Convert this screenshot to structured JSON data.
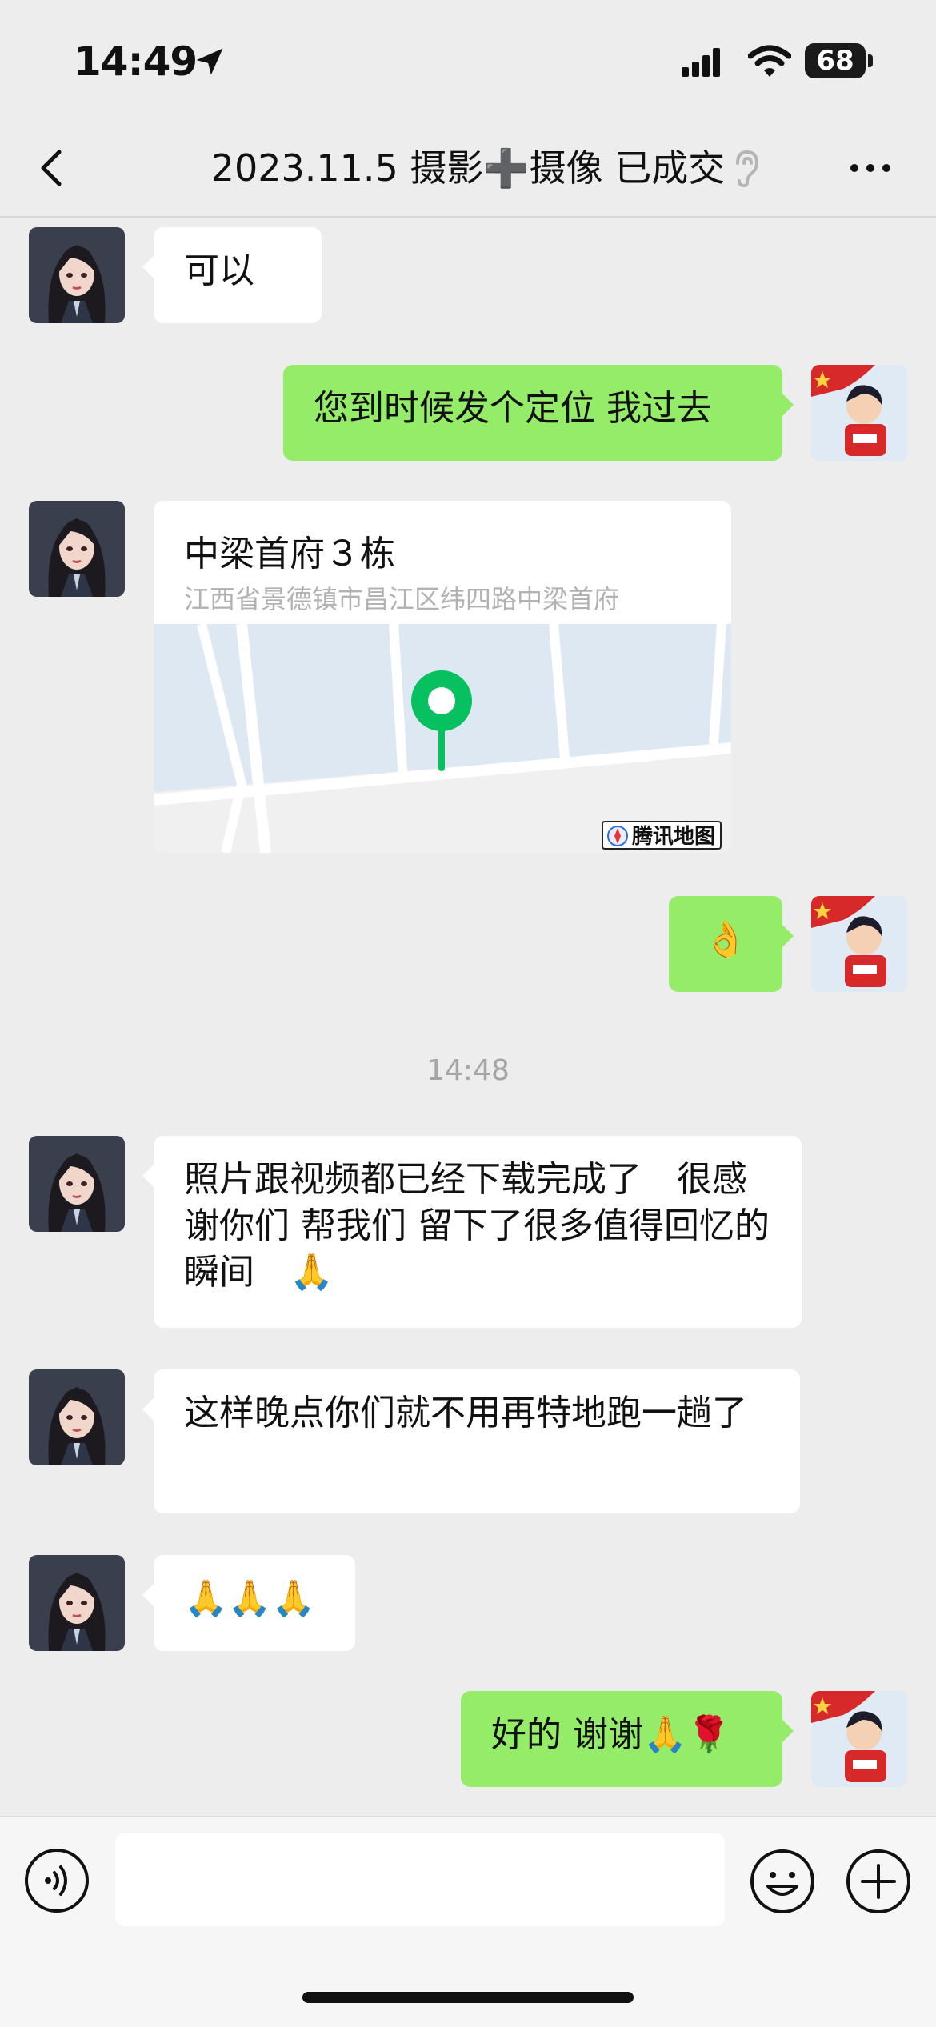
{
  "status": {
    "time": "14:49",
    "battery": "68"
  },
  "nav": {
    "title": "2023.11.5 摄影➕摄像 已成交"
  },
  "messages": {
    "m1": "可以",
    "m2": "您到时候发个定位 我过去",
    "loc_name": "中梁首府３栋",
    "loc_addr": "江西省景德镇市昌江区纬四路中梁首府",
    "map_badge": "腾讯地图",
    "m3": "👌",
    "timestamp": "14:48",
    "m4": "照片跟视频都已经下载完成了　很感谢你们  帮我们 留下了很多值得回忆的瞬间　🙏",
    "m5": "这样晚点你们就不用再特地跑一趟了",
    "m6": "🙏🙏🙏",
    "m7": "好的 谢谢🙏🌹"
  },
  "colors": {
    "outgoing": "#95ec69",
    "incoming": "#ffffff",
    "background": "#ededed",
    "pin": "#07c160"
  },
  "icons": [
    "location-arrow-icon",
    "signal-icon",
    "wifi-icon",
    "battery-icon",
    "back-icon",
    "ear-icon",
    "more-icon",
    "voice-icon",
    "emoji-icon",
    "plus-icon",
    "map-pin-icon"
  ]
}
